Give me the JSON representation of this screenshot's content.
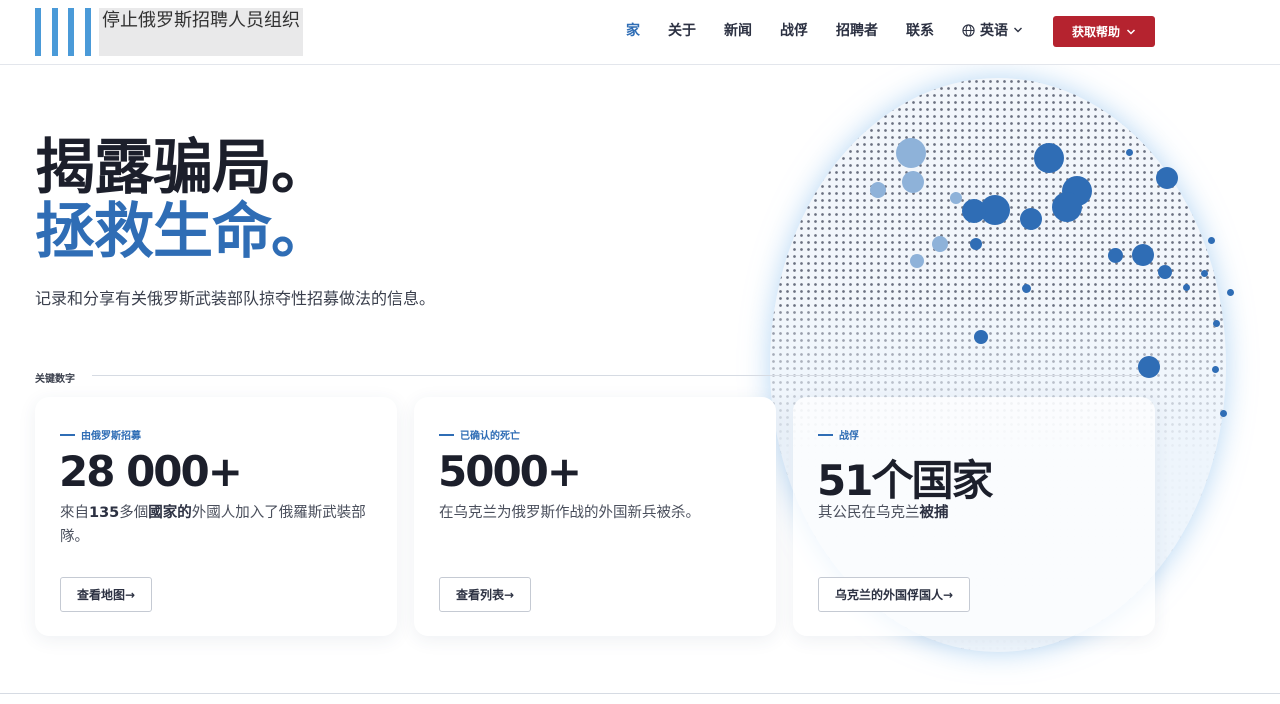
{
  "brand": {
    "logo_text": "停止俄罗斯招聘人员组织"
  },
  "nav": {
    "items": [
      {
        "label": "家",
        "active": true
      },
      {
        "label": "关于"
      },
      {
        "label": "新闻"
      },
      {
        "label": "战俘"
      },
      {
        "label": "招聘者"
      },
      {
        "label": "联系"
      }
    ],
    "language": "英语",
    "help_button": "获取帮助"
  },
  "hero": {
    "title_line1": "揭露骗局。",
    "title_line2": "拯救生命。",
    "subtitle": "记录和分享有关俄罗斯武装部队掠夺性招募做法的信息。"
  },
  "stats": {
    "section_label": "关键数字",
    "cards": [
      {
        "tag": "由俄罗斯招募",
        "value": "28 000+",
        "desc_parts": [
          "來自",
          "135",
          "多個",
          "國家的",
          "外國人加入了俄羅斯武裝部隊。"
        ],
        "button": "查看地图→"
      },
      {
        "tag": "已确认的死亡",
        "value": "5000+",
        "desc": "在乌克兰为俄罗斯作战的外国新兵被杀。",
        "button": "查看列表→"
      },
      {
        "tag": "战俘",
        "value": "51个国家",
        "desc_parts": [
          "其公民在乌克兰",
          "被捕"
        ],
        "button": "乌克兰的外国俘国人→"
      }
    ]
  },
  "colors": {
    "accent": "#2f6db5",
    "help": "#b5232f",
    "text": "#1c1f2b"
  }
}
